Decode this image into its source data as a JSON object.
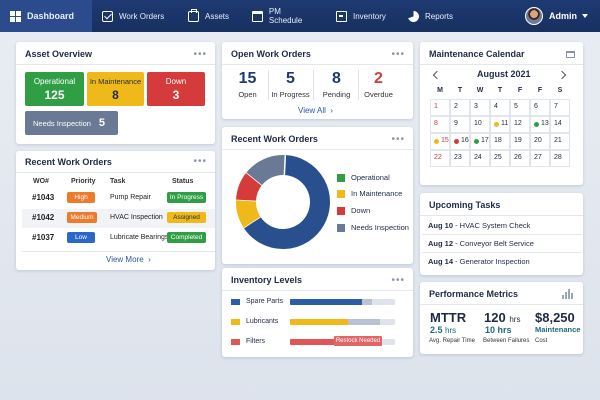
{
  "nav": {
    "items": [
      {
        "label": "Dashboard",
        "icon": "grid-icon"
      },
      {
        "label": "Work Orders",
        "icon": "check-icon"
      },
      {
        "label": "Assets",
        "icon": "toolbox-icon"
      },
      {
        "label": "PM Schedule",
        "icon": "calendar-check-icon"
      },
      {
        "label": "Inventory",
        "icon": "stock-icon"
      },
      {
        "label": "Reports",
        "icon": "pie-icon"
      }
    ],
    "user": "Admin"
  },
  "asset_overview": {
    "title": "Asset Overview",
    "operational": {
      "label": "Operational",
      "value": "125"
    },
    "maintenance": {
      "label": "In Maintenance",
      "value": "8"
    },
    "down": {
      "label": "Down",
      "value": "3"
    },
    "needs": {
      "label": "Needs Inspection",
      "value": "5"
    }
  },
  "recent_table": {
    "title": "Recent Work Orders",
    "headers": [
      "WO#",
      "Priority",
      "Task",
      "Status"
    ],
    "rows": [
      {
        "wo": "#1043",
        "priority": "High",
        "task": "Pump Repair",
        "status": "In Progress"
      },
      {
        "wo": "#1042",
        "priority": "Medium",
        "task": "HVAC Inspection",
        "status": "Assigned"
      },
      {
        "wo": "#1037",
        "priority": "Low",
        "task": "Lubricate Bearings",
        "status": "Completed"
      }
    ],
    "view_more": "View More"
  },
  "open_wo": {
    "title": "Open Work Orders",
    "kpis": [
      {
        "value": "15",
        "label": "Open"
      },
      {
        "value": "5",
        "label": "In Progress"
      },
      {
        "value": "8",
        "label": "Pending"
      },
      {
        "value": "2",
        "label": "Overdue"
      }
    ],
    "view_all": "View All"
  },
  "donut": {
    "title": "Recent Work Orders",
    "legend": [
      {
        "label": "Operational",
        "color": "#2f9e44"
      },
      {
        "label": "In Maintenance",
        "color": "#f0b91a"
      },
      {
        "label": "Down",
        "color": "#d63b3b"
      },
      {
        "label": "Needs Inspection",
        "color": "#6b7a94"
      }
    ]
  },
  "chart_data": {
    "type": "pie",
    "categories": [
      "Operational",
      "In Maintenance",
      "Down",
      "Needs Inspection"
    ],
    "values": [
      65,
      10,
      10,
      15
    ]
  },
  "inventory": {
    "title": "Inventory Levels",
    "items": [
      {
        "label": "Spare Parts",
        "color": "#2a5fa8",
        "level": 0.72
      },
      {
        "label": "Lubricants",
        "color": "#f0b91a",
        "level": 0.55
      },
      {
        "label": "Filters",
        "color": "#e05555",
        "level": 0.43
      }
    ],
    "restock": "Restock Needed"
  },
  "calendar": {
    "title": "Maintenance Calendar",
    "month": "August 2021",
    "weekdays": [
      "M",
      "T",
      "W",
      "T",
      "F",
      "F",
      "S"
    ],
    "days": [
      "1",
      "2",
      "3",
      "4",
      "5",
      "6",
      "7",
      "8",
      "9",
      "10",
      "11",
      "12",
      "13",
      "14",
      "15",
      "16",
      "17",
      "18",
      "19",
      "20",
      "21",
      "22",
      "23",
      "24",
      "25",
      "26",
      "27",
      "28"
    ]
  },
  "tasks": {
    "title": "Upcoming Tasks",
    "items": [
      {
        "date": "Aug 10",
        "text": " - HVAC System Check"
      },
      {
        "date": "Aug 12",
        "text": " - Conveyor Belt Service"
      },
      {
        "date": "Aug 14",
        "text": " - Generator Inspection"
      }
    ]
  },
  "performance": {
    "title": "Performance Metrics",
    "mttr_label": "MTTR",
    "mttr_value": "2.5",
    "mttr_unit": "hrs",
    "mttr_caption": "Avg. Repair Time",
    "mtbf_value": "120",
    "mtbf_unit": "hrs",
    "mtbf_sub": "10 hrs",
    "mtbf_caption": "Between Failures",
    "cost_value": "$8,250",
    "cost_sub": "Maintenance",
    "cost_caption": "Cost"
  }
}
